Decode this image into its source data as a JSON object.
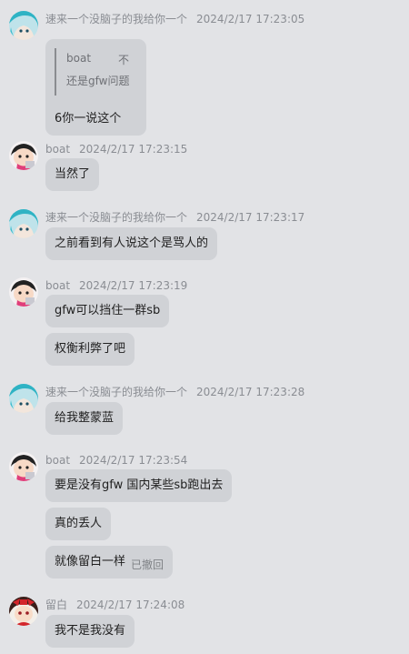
{
  "messages": [
    {
      "sender": "速来一个没脑子的我给你一个",
      "time": "2024/2/17 17:23:05",
      "avatar": "anime-cyan-hair-avatar",
      "quote": {
        "author": "boat",
        "preview": "不",
        "text": "还是gfw问题"
      },
      "reply": "6你一说这个"
    },
    {
      "sender": "boat",
      "time": "2024/2/17 17:23:15",
      "avatar": "anime-shinchan-avatar",
      "bubbles": [
        "当然了"
      ]
    },
    {
      "sender": "速来一个没脑子的我给你一个",
      "time": "2024/2/17 17:23:17",
      "avatar": "anime-cyan-hair-avatar",
      "bubbles": [
        "之前看到有人说这个是骂人的"
      ]
    },
    {
      "sender": "boat",
      "time": "2024/2/17 17:23:19",
      "avatar": "anime-shinchan-avatar",
      "bubbles": [
        "gfw可以挡住一群sb",
        "权衡利弊了吧"
      ]
    },
    {
      "sender": "速来一个没脑子的我给你一个",
      "time": "2024/2/17 17:23:28",
      "avatar": "anime-cyan-hair-avatar",
      "bubbles": [
        "给我整蒙蓝"
      ]
    },
    {
      "sender": "boat",
      "time": "2024/2/17 17:23:54",
      "avatar": "anime-shinchan-avatar",
      "bubbles": [
        "要是没有gfw 国内某些sb跑出去",
        "真的丢人",
        "就像留白一样"
      ],
      "recalled_label": "已撤回"
    },
    {
      "sender": "留白",
      "time": "2024/2/17 17:24:08",
      "avatar": "anime-red-bow-avatar",
      "bubbles": [
        "我不是我没有"
      ]
    }
  ]
}
